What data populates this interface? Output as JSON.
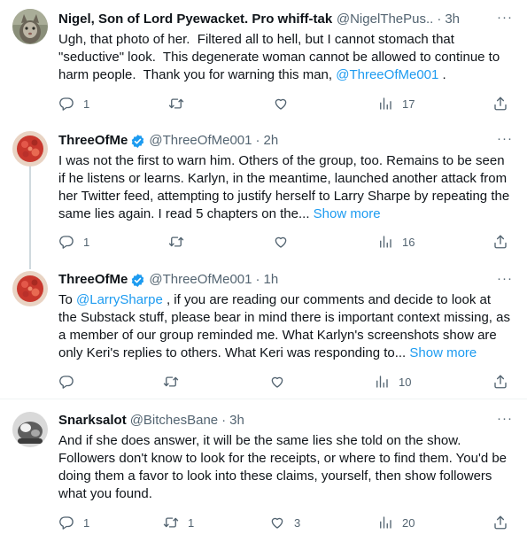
{
  "tweets": [
    {
      "name": "Nigel, Son of Lord Pyewacket. Pro whiff-tak...",
      "handle": "@NigelThePus...",
      "time": "3h",
      "verified": false,
      "text_before": "Ugh, that photo of her.  Filtered all to hell, but I cannot stomach that \"seductive\" look.  This degenerate woman cannot be allowed to continue to harm people.  Thank you for warning this man, ",
      "mention": "@ThreeOfMe001",
      "text_after": " .",
      "show_more": "",
      "replies": "1",
      "retweets": "",
      "likes": "",
      "views": "17"
    },
    {
      "name": "ThreeOfMe",
      "handle": "@ThreeOfMe001",
      "time": "2h",
      "verified": true,
      "text_before": "I was not the first to warn him. Others of the group, too. Remains to be seen if he listens or learns. Karlyn, in the meantime, launched another attack from her Twitter feed, attempting to justify herself to Larry Sharpe by repeating the same lies again. I read 5 chapters on the... ",
      "mention": "",
      "text_after": "",
      "show_more": "Show more",
      "replies": "1",
      "retweets": "",
      "likes": "",
      "views": "16"
    },
    {
      "name": "ThreeOfMe",
      "handle": "@ThreeOfMe001",
      "time": "1h",
      "verified": true,
      "text_prefix": "To ",
      "mention": "@LarrySharpe",
      "text_after": " , if you are reading our comments and decide to look at the Substack stuff, please bear in mind there is important context missing, as a member of our group reminded me. What Karlyn's screenshots show are only Keri's replies to others. What Keri was responding to... ",
      "show_more": "Show more",
      "replies": "",
      "retweets": "",
      "likes": "",
      "views": "10"
    },
    {
      "name": "Snarksalot",
      "handle": "@BitchesBane",
      "time": "3h",
      "verified": false,
      "text_before": "And if she does answer, it will be the same lies she told on the show. Followers don't know to look for the receipts, or where to find them. You'd be doing them a favor to look into these claims, yourself, then show followers what you found.",
      "mention": "",
      "text_after": "",
      "show_more": "",
      "replies": "1",
      "retweets": "1",
      "likes": "3",
      "views": "20"
    }
  ],
  "separator_dot": "·",
  "more_glyph": "···",
  "colors": {
    "link": "#1d9bf0",
    "secondary_text": "#536471",
    "thread_line": "#cfd9de",
    "verified": "#1d9bf0"
  }
}
